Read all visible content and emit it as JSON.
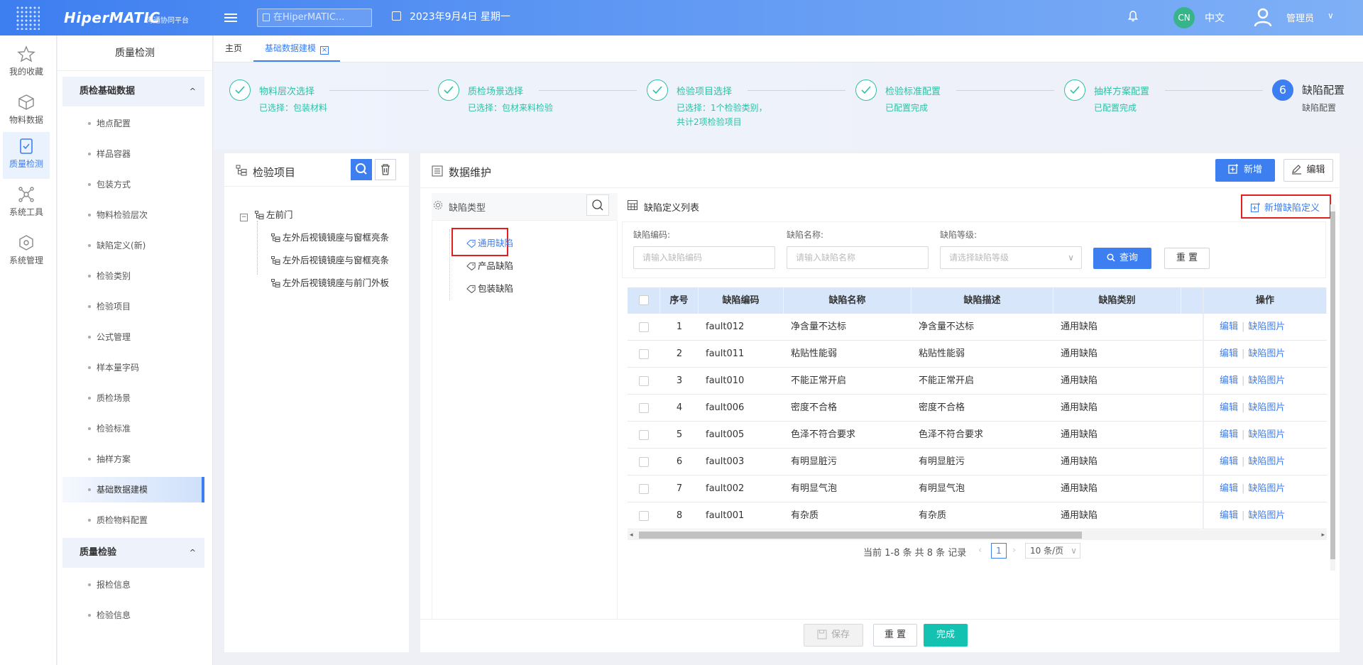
{
  "topbar": {
    "brand": "HiperMATIC",
    "brand_sub": "海通协同平台",
    "search_placeholder": "在HiperMATIC...",
    "date": "2023年9月4日 星期一",
    "lang_badge": "CN",
    "lang_text": "中文",
    "user": "管理员"
  },
  "leftnav": [
    {
      "label": "我的收藏",
      "icon": "star-icon"
    },
    {
      "label": "物料数据",
      "icon": "box-icon"
    },
    {
      "label": "质量检测",
      "icon": "shield-icon"
    },
    {
      "label": "系统工具",
      "icon": "network-icon"
    },
    {
      "label": "系统管理",
      "icon": "cube-icon"
    }
  ],
  "sidebar": {
    "title": "质量检测",
    "group1": "质检基础数据",
    "items1": [
      "地点配置",
      "样品容器",
      "包装方式",
      "物料检验层次",
      "缺陷定义(新)",
      "检验类别",
      "检验项目",
      "公式管理",
      "样本量字码",
      "质检场景",
      "检验标准",
      "抽样方案",
      "基础数据建模",
      "质检物料配置"
    ],
    "group2": "质量检验",
    "items2": [
      "报检信息",
      "检验信息"
    ]
  },
  "tabs": [
    "主页",
    "基础数据建模"
  ],
  "steps": [
    {
      "title": "物料层次选择",
      "desc": "已选择：包装材料"
    },
    {
      "title": "质检场景选择",
      "desc": "已选择：包材来料检验"
    },
    {
      "title": "检验项目选择",
      "desc": "已选择：1个检验类别，共计2项检验项目"
    },
    {
      "title": "检验标准配置",
      "desc": "已配置完成"
    },
    {
      "title": "抽样方案配置",
      "desc": "已配置完成"
    },
    {
      "num": "6",
      "title": "缺陷配置",
      "desc": "缺陷配置"
    }
  ],
  "left_panel": {
    "title": "检验项目",
    "tree_root": "左前门",
    "tree_children": [
      "左外后视镜镜座与窗框亮条",
      "左外后视镜镜座与窗框亮条",
      "左外后视镜镜座与前门外板"
    ]
  },
  "main_panel": {
    "title": "数据维护",
    "add": "新增",
    "edit": "编辑",
    "defect_type_title": "缺陷类型",
    "defect_types": [
      "通用缺陷",
      "产品缺陷",
      "包装缺陷"
    ],
    "list_title": "缺陷定义列表",
    "add_defect": "新增缺陷定义",
    "filters": {
      "code_label": "缺陷编码:",
      "code_placeholder": "请输入缺陷编码",
      "name_label": "缺陷名称:",
      "name_placeholder": "请输入缺陷名称",
      "level_label": "缺陷等级:",
      "level_placeholder": "请选择缺陷等级",
      "query": "查询",
      "reset": "重 置"
    },
    "columns": [
      "序号",
      "缺陷编码",
      "缺陷名称",
      "缺陷描述",
      "缺陷类别",
      "操作"
    ],
    "rows": [
      [
        "1",
        "fault012",
        "净含量不达标",
        "净含量不达标",
        "通用缺陷"
      ],
      [
        "2",
        "fault011",
        "粘贴性能弱",
        "粘贴性能弱",
        "通用缺陷"
      ],
      [
        "3",
        "fault010",
        "不能正常开启",
        "不能正常开启",
        "通用缺陷"
      ],
      [
        "4",
        "fault006",
        "密度不合格",
        "密度不合格",
        "通用缺陷"
      ],
      [
        "5",
        "fault005",
        "色泽不符合要求",
        "色泽不符合要求",
        "通用缺陷"
      ],
      [
        "6",
        "fault003",
        "有明显脏污",
        "有明显脏污",
        "通用缺陷"
      ],
      [
        "7",
        "fault002",
        "有明显气泡",
        "有明显气泡",
        "通用缺陷"
      ],
      [
        "8",
        "fault001",
        "有杂质",
        "有杂质",
        "通用缺陷"
      ]
    ],
    "row_action_edit": "编辑",
    "row_action_img": "缺陷图片",
    "pagination": {
      "summary": "当前 1-8 条 共 8 条 记录",
      "page": "1",
      "size": "10 条/页"
    }
  },
  "footer": {
    "save": "保存",
    "reset": "重 置",
    "done": "完成"
  },
  "colors": {
    "primary": "#3d7ef0",
    "success": "#2fc0a5",
    "highlight": "#e02020"
  }
}
